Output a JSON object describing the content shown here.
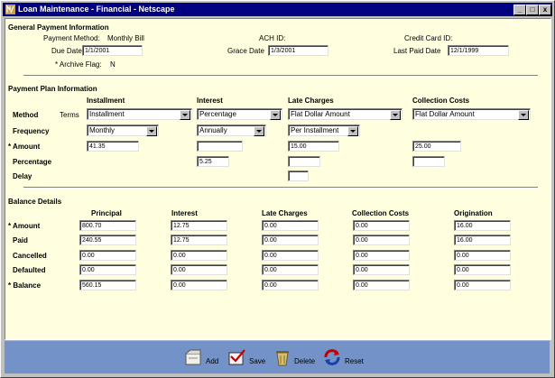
{
  "window": {
    "title": "Loan Maintenance - Financial  - Netscape",
    "minimize": "_",
    "maximize": "□",
    "close": "x"
  },
  "general": {
    "section_title": "General Payment Information",
    "payment_method_label": "Payment Method:",
    "payment_method_value": "Monthly Bill",
    "ach_label": "ACH ID:",
    "credit_card_label": "Credit Card ID:",
    "due_date_label": "Due Date",
    "due_date_value": "1/1/2001",
    "grace_date_label": "Grace Date",
    "grace_date_value": "1/3/2001",
    "last_paid_label": "Last Paid Date",
    "last_paid_value": "12/1/1999",
    "archive_label": "* Archive Flag:",
    "archive_value": "N"
  },
  "plan": {
    "section_title": "Payment Plan Information",
    "columns": [
      "Installment",
      "Interest",
      "Late Charges",
      "Collection Costs"
    ],
    "method_label": "Method",
    "terms_label": "Terms",
    "method_values": [
      "Installment",
      "Percentage",
      "Flat Dollar Amount",
      "Flat Dollar Amount"
    ],
    "frequency_label": "Frequency",
    "frequency_values": [
      "Monthly",
      "Annually",
      "Per Installment"
    ],
    "amount_label": "* Amount",
    "amount_values": [
      "41.35",
      "",
      "15.00",
      "25.00"
    ],
    "percentage_label": "Percentage",
    "percentage_values": [
      "5.25",
      "",
      ""
    ],
    "delay_label": "Delay",
    "delay_value": ""
  },
  "balance": {
    "section_title": "Balance Details",
    "columns": [
      "Principal",
      "Interest",
      "Late Charges",
      "Collection Costs",
      "Origination"
    ],
    "rows": [
      {
        "label": "* Amount",
        "values": [
          "800.70",
          "12.75",
          "0.00",
          "0.00",
          "16.00"
        ]
      },
      {
        "label": "Paid",
        "values": [
          "240.55",
          "12.75",
          "0.00",
          "0.00",
          "16.00"
        ]
      },
      {
        "label": "Cancelled",
        "values": [
          "0.00",
          "0.00",
          "0.00",
          "0.00",
          "0.00"
        ]
      },
      {
        "label": "Defaulted",
        "values": [
          "0.00",
          "0.00",
          "0.00",
          "0.00",
          "0.00"
        ]
      },
      {
        "label": "* Balance",
        "values": [
          "560.15",
          "0.00",
          "0.00",
          "0.00",
          "0.00"
        ]
      }
    ]
  },
  "footer": {
    "add": "Add",
    "save": "Save",
    "delete": "Delete",
    "reset": "Reset"
  },
  "colors": {
    "titlebar": "#000080",
    "content_bg": "#ffffe0",
    "footer_bg": "#7393c8"
  }
}
